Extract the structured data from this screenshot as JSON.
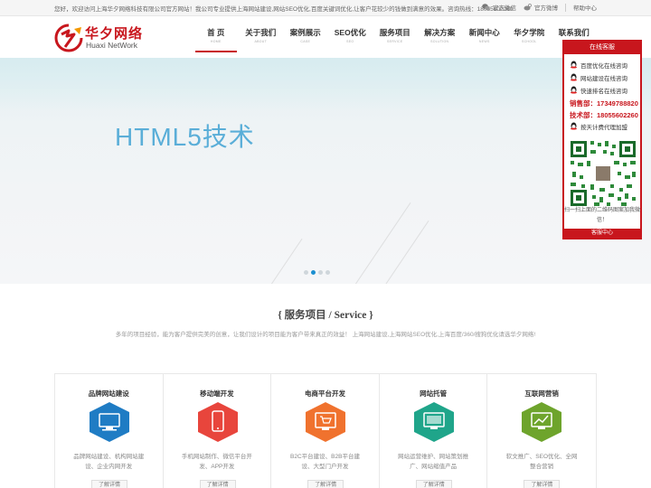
{
  "topbar": {
    "welcome": "您好，欢迎访问上海华夕网络科技有限公司官方网站！我公司专业提供上海网站建设,网站SEO优化,百度关键词优化,让客户花较少的钱做到满意的效果。咨询热线：18055602260",
    "links": [
      "官方微信",
      "官方微博",
      "帮助中心"
    ]
  },
  "logo": {
    "cn": "华夕网络",
    "en": "Huaxi NetWork"
  },
  "nav": [
    {
      "label": "首 页",
      "sub": "HOME"
    },
    {
      "label": "关于我们",
      "sub": "ABOUT"
    },
    {
      "label": "案例展示",
      "sub": "CASE"
    },
    {
      "label": "SEO优化",
      "sub": "SEO"
    },
    {
      "label": "服务项目",
      "sub": "SERVICE"
    },
    {
      "label": "解决方案",
      "sub": "SOLUTION"
    },
    {
      "label": "新闻中心",
      "sub": "NEWS"
    },
    {
      "label": "华夕学院",
      "sub": "SCHOOL"
    },
    {
      "label": "联系我们",
      "sub": "CONTACT"
    }
  ],
  "banner": {
    "title": "HTML5技术",
    "slide_count": 4,
    "active_slide": 2
  },
  "service": {
    "title": "{ 服务项目 / Service }",
    "desc": "多年的项目经验，能为客户提供完美的创意，让我们设计的项目能为客户带来真正的效益！ 上海网站建设,上海网站SEO优化,上海百度/360/搜狗优化请选华夕网络!",
    "items": [
      {
        "name": "品牌网站建设",
        "desc": "品牌网站建设、机构网站建设、企业内网开发",
        "color": "#1f7cc4",
        "icon": "monitor-icon",
        "more": "了解详情"
      },
      {
        "name": "移动端开发",
        "desc": "手机网站制作、微信平台开发、APP开发",
        "color": "#e8453c",
        "icon": "mobile-icon",
        "more": "了解详情"
      },
      {
        "name": "电商平台开发",
        "desc": "B2C平台建设、B2B平台建设、大型门户开发",
        "color": "#f0722e",
        "icon": "cart-icon",
        "more": "了解详情"
      },
      {
        "name": "网站托管",
        "desc": "网站运营维护、网站策划推广、网站缩值产品",
        "color": "#1fa58a",
        "icon": "hosting-icon",
        "more": "了解详情"
      },
      {
        "name": "互联网营销",
        "desc": "软文推广、SEO优化、全网整合营销",
        "color": "#6ea42c",
        "icon": "chart-icon",
        "more": "了解详情"
      }
    ]
  },
  "float_panel": {
    "title": "在线客服",
    "qq": [
      "百度优化在线咨询",
      "网站建设在线咨询",
      "快速排名在线咨询"
    ],
    "sales": "销售部：17349788820",
    "tech": "技术部：18055602260",
    "agent": "按天计费代理加盟",
    "qr_text": "扫一扫上面的二维码图案加我微信！",
    "footer": "客服中心"
  },
  "colors": {
    "brand": "#c8161d",
    "accent": "#1c8fd0"
  }
}
